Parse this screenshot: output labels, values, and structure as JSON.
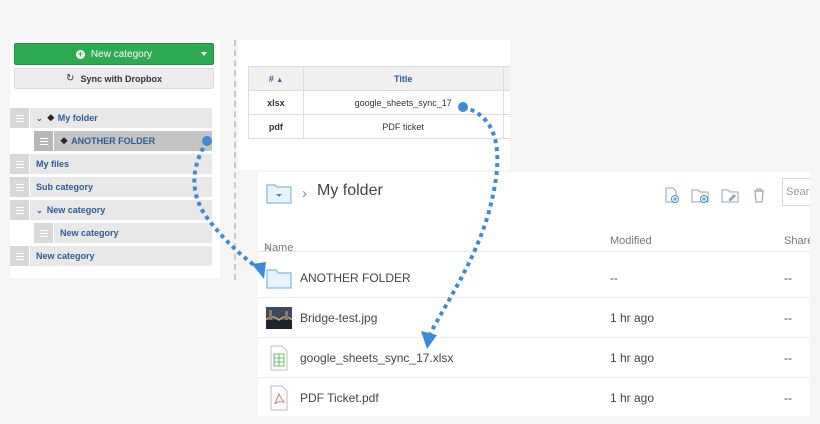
{
  "left_panel": {
    "new_category_label": "New category",
    "sync_label": "Sync with Dropbox",
    "categories": [
      {
        "label": "My folder",
        "expanded": true,
        "dropbox": true
      },
      {
        "label": "ANOTHER FOLDER",
        "dropbox": true,
        "selected": true
      },
      {
        "label": "My files"
      },
      {
        "label": "Sub category"
      },
      {
        "label": "New category",
        "expanded": true
      },
      {
        "label": "New category"
      },
      {
        "label": "New category"
      }
    ]
  },
  "table": {
    "headers": {
      "id": "#",
      "title": "Title"
    },
    "rows": [
      {
        "id": "xlsx",
        "title": "google_sheets_sync_17"
      },
      {
        "id": "pdf",
        "title": "PDF ticket"
      }
    ]
  },
  "file_manager": {
    "breadcrumb_title": "My folder",
    "search_placeholder": "Sear",
    "columns": {
      "name": "Name",
      "modified": "Modified",
      "shared": "Share"
    },
    "rows": [
      {
        "name": "ANOTHER FOLDER",
        "modified": "--",
        "shared": "--",
        "icon": "folder-icon"
      },
      {
        "name": "Bridge-test.jpg",
        "modified": "1 hr ago",
        "shared": "--",
        "icon": "image-thumbnail"
      },
      {
        "name": "google_sheets_sync_17.xlsx",
        "modified": "1 hr ago",
        "shared": "--",
        "icon": "spreadsheet-icon"
      },
      {
        "name": "PDF Ticket.pdf",
        "modified": "1 hr ago",
        "shared": "--",
        "icon": "pdf-icon"
      }
    ]
  },
  "colors": {
    "accent_green": "#2eaa52",
    "link_blue": "#2b5d9a",
    "arrow_blue": "#3f8ad8",
    "folder_blue": "#7fb8e6"
  }
}
